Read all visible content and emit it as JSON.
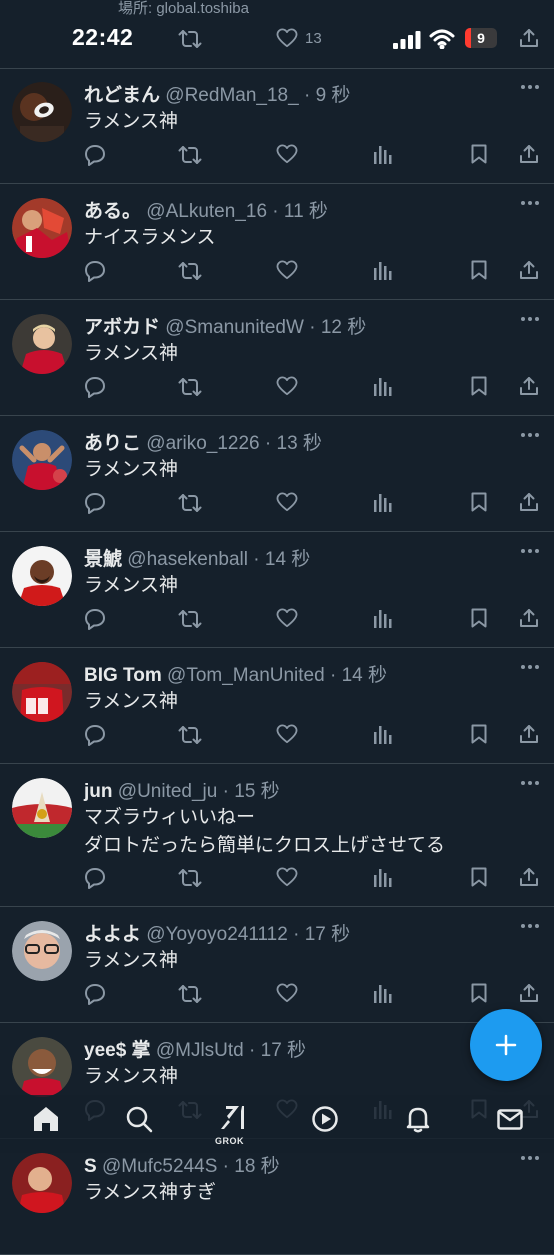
{
  "status_bar": {
    "location": "場所: global.toshiba",
    "time": "22:42",
    "behind_like_count": "13",
    "battery_level": "9"
  },
  "tweets": [
    {
      "name": "れどまん",
      "handle": "@RedMan_18_",
      "time": "9 秒",
      "lines": [
        "ラメンス神"
      ]
    },
    {
      "name": "ある。",
      "handle": "@ALkuten_16",
      "time": "11 秒",
      "lines": [
        "ナイスラメンス"
      ]
    },
    {
      "name": "アボカド",
      "handle": "@SmanunitedW",
      "time": "12 秒",
      "lines": [
        "ラメンス神"
      ]
    },
    {
      "name": "ありこ",
      "handle": "@ariko_1226",
      "time": "13 秒",
      "lines": [
        "ラメンス神"
      ]
    },
    {
      "name": "景鯱",
      "handle": "@hasekenball",
      "time": "14 秒",
      "lines": [
        "ラメンス神"
      ]
    },
    {
      "name": "BIG Tom",
      "handle": "@Tom_ManUnited",
      "time": "14 秒",
      "lines": [
        "ラメンス神"
      ]
    },
    {
      "name": "jun",
      "handle": "@United_ju",
      "time": "15 秒",
      "lines": [
        "マズラウィいいねー",
        "ダロトだったら簡単にクロス上げさせてる"
      ]
    },
    {
      "name": "よよよ",
      "handle": "@Yoyoyo241112",
      "time": "17 秒",
      "lines": [
        "ラメンス神"
      ]
    },
    {
      "name": "yee$ 掌",
      "handle": "@MJlsUtd",
      "time": "17 秒",
      "lines": [
        "ラメンス神"
      ]
    },
    {
      "name": "S",
      "handle": "@Mufc5244S",
      "time": "18 秒",
      "lines": [
        "ラメンス神すぎ"
      ]
    }
  ],
  "bottom_nav": {
    "grok_label": "GROK",
    "items": [
      "home-icon",
      "search-icon",
      "grok-icon",
      "video-icon",
      "notifications-icon",
      "messages-icon"
    ]
  },
  "colors": {
    "background": "#15202b",
    "divider": "#38444d",
    "text_primary": "#e7e9ea",
    "text_secondary": "#8b98a5",
    "accent": "#1d9bf0",
    "battery_low": "#ff3b30"
  }
}
